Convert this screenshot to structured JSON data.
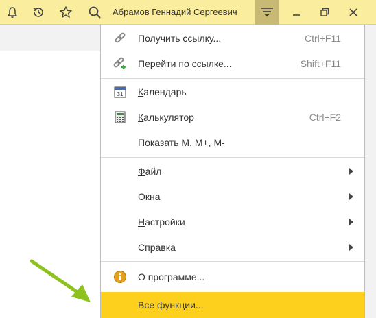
{
  "topbar": {
    "user_name": "Абрамов Геннадий Сергеевич",
    "icons": [
      "bell-icon",
      "history-icon",
      "star-icon",
      "search-icon",
      "main-menu-icon",
      "minimize-icon",
      "restore-icon",
      "close-icon"
    ]
  },
  "menu": {
    "get_link": {
      "label": "Получить ссылку...",
      "shortcut": "Ctrl+F11"
    },
    "go_to_link": {
      "label": "Перейти по ссылке...",
      "shortcut": "Shift+F11"
    },
    "calendar": {
      "label_first": "К",
      "label_rest": "алендарь",
      "icon_text": "31"
    },
    "calculator": {
      "label_first": "К",
      "label_rest": "алькулятор",
      "shortcut": "Ctrl+F2"
    },
    "show_m": {
      "label": "Показать M, M+, M-"
    },
    "file": {
      "label_first": "Ф",
      "label_rest": "айл"
    },
    "windows": {
      "label_first": "О",
      "label_rest": "кна"
    },
    "settings": {
      "label_first": "Н",
      "label_rest": "астройки"
    },
    "help": {
      "label_first": "С",
      "label_rest": "правка"
    },
    "about": {
      "label": "О программе..."
    },
    "all_functions": {
      "label": "Все функции..."
    }
  },
  "colors": {
    "topbar_bg": "#fbed9e",
    "menu_button_active": "#c8ba74",
    "highlight": "#fcd01c",
    "arrow_annotation": "#8dc21f"
  }
}
